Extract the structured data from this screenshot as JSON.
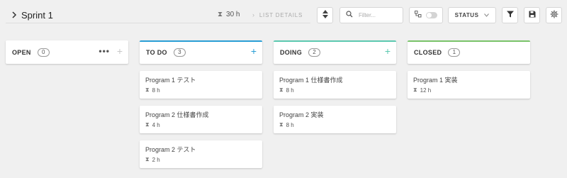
{
  "header": {
    "chevron_icon": "chevron-right-icon",
    "sprint_title": "Sprint 1",
    "total_hours": "30 h",
    "list_details": "LIST DETAILS",
    "search_placeholder": "Filter...",
    "status_label": "STATUS"
  },
  "colors": {
    "todo": "#2a9fd6",
    "doing": "#5cc9b0",
    "closed": "#7ac46a"
  },
  "columns": [
    {
      "name": "OPEN",
      "count": "0",
      "cards": []
    },
    {
      "name": "TO DO",
      "count": "3",
      "cards": [
        {
          "title": "Program 1 テスト",
          "effort": "8 h"
        },
        {
          "title": "Program 2 仕様書作成",
          "effort": "4 h"
        },
        {
          "title": "Program 2 テスト",
          "effort": "2 h"
        }
      ]
    },
    {
      "name": "DOING",
      "count": "2",
      "cards": [
        {
          "title": "Program 1 仕様書作成",
          "effort": "8 h"
        },
        {
          "title": "Program 2 実装",
          "effort": "8 h"
        }
      ]
    },
    {
      "name": "CLOSED",
      "count": "1",
      "cards": [
        {
          "title": "Program 1 実装",
          "effort": "12 h"
        }
      ]
    }
  ]
}
